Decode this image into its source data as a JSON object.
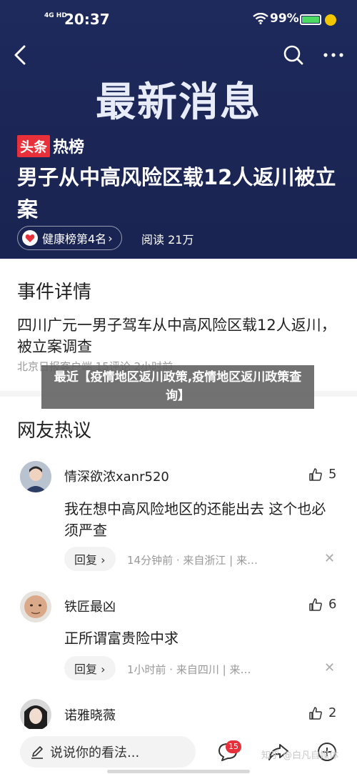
{
  "status_bar": {
    "network": "4G HD",
    "time": "20:37",
    "battery": "99%"
  },
  "nav": {
    "back_icon": "back-chevron-icon",
    "search_icon": "search-icon",
    "more_icon": "more-dots-icon"
  },
  "banner": {
    "title": "最新消息"
  },
  "hot": {
    "tag": "头条",
    "tag_suffix": "热榜"
  },
  "headline": "男子从中高风险区载12人返川被立案",
  "rank": {
    "label": "健康榜第4名",
    "chevron": "›"
  },
  "reads": "阅读  21万",
  "event": {
    "section_title": "事件详情",
    "text": "四川广元一男子驾车从中高风险区载12人返川，被立案调查",
    "meta": "北京日报客户端  15评论  2小时前"
  },
  "overlay": {
    "text": "最近【疫情地区返川政策,疫情地区返川政策查询】"
  },
  "discussion": {
    "section_title": "网友热议",
    "comments": [
      {
        "name": "情深欲浓xanr520",
        "likes": "5",
        "text": "我在想中高风险地区的还能出去 这个也必须严查",
        "reply": "回复 ›",
        "meta": "14分钟前 · 来自浙江 | 来…",
        "close": "✕"
      },
      {
        "name": "铁匠最凶",
        "likes": "6",
        "text": "正所谓富贵险中求",
        "reply": "回复 ›",
        "meta": "1小时前 · 来自四川 | 来…",
        "close": "✕"
      },
      {
        "name": "诺雅晓薇",
        "likes": "2"
      }
    ]
  },
  "bottom": {
    "input_placeholder": "说说你的看法...",
    "comment_badge": "15",
    "watermark": "知乎 @白凡自媒体"
  },
  "colors": {
    "header_bg": "#1e2a5c",
    "hot_red": "#e8303a",
    "battery_green": "#4cd964"
  }
}
